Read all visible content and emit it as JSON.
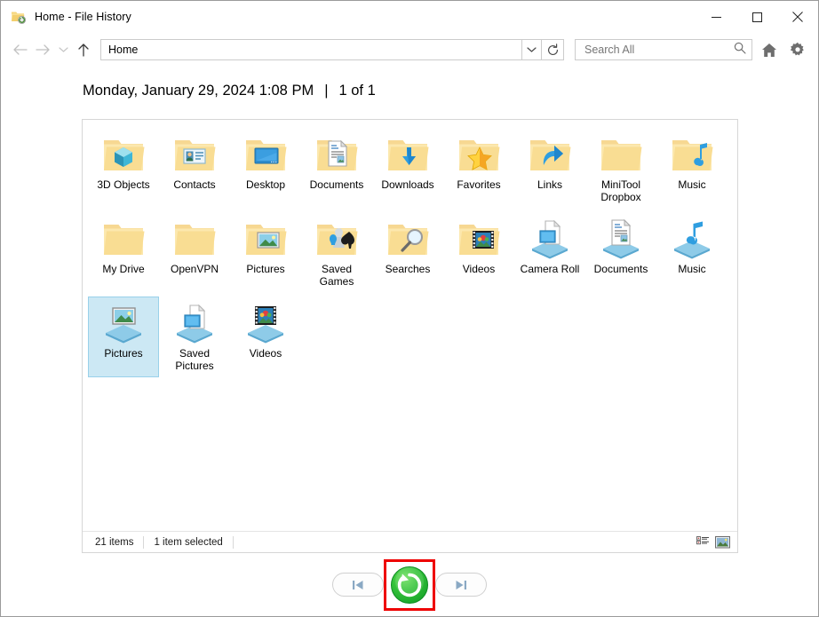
{
  "window": {
    "title": "Home - File History",
    "icon": "folder-history-icon",
    "minimize_label": "Minimize",
    "maximize_label": "Maximize",
    "close_label": "Close"
  },
  "toolbar": {
    "back_label": "Back",
    "forward_label": "Forward",
    "recent_label": "Recent locations",
    "up_label": "Up",
    "address_value": "Home",
    "address_chevron": "chevron-down-icon",
    "refresh_label": "Refresh",
    "search_placeholder": "Search All",
    "search_value": "",
    "home_label": "Home",
    "settings_label": "Settings"
  },
  "header": {
    "datetime": "Monday, January 29, 2024 1:08 PM",
    "separator": "|",
    "version_count": "1 of 1"
  },
  "items": [
    {
      "label": "3D Objects",
      "icon": "folder-3d-objects-icon",
      "selected": false
    },
    {
      "label": "Contacts",
      "icon": "folder-contacts-icon",
      "selected": false
    },
    {
      "label": "Desktop",
      "icon": "folder-desktop-icon",
      "selected": false
    },
    {
      "label": "Documents",
      "icon": "folder-documents-icon",
      "selected": false
    },
    {
      "label": "Downloads",
      "icon": "folder-downloads-icon",
      "selected": false
    },
    {
      "label": "Favorites",
      "icon": "folder-favorites-icon",
      "selected": false
    },
    {
      "label": "Links",
      "icon": "folder-links-icon",
      "selected": false
    },
    {
      "label": "MiniTool Dropbox",
      "icon": "folder-plain-icon",
      "selected": false
    },
    {
      "label": "Music",
      "icon": "folder-music-icon",
      "selected": false
    },
    {
      "label": "My Drive",
      "icon": "folder-plain-icon",
      "selected": false
    },
    {
      "label": "OpenVPN",
      "icon": "folder-plain-icon",
      "selected": false
    },
    {
      "label": "Pictures",
      "icon": "folder-pictures-icon",
      "selected": false
    },
    {
      "label": "Saved Games",
      "icon": "folder-saved-games-icon",
      "selected": false
    },
    {
      "label": "Searches",
      "icon": "folder-searches-icon",
      "selected": false
    },
    {
      "label": "Videos",
      "icon": "folder-videos-icon",
      "selected": false
    },
    {
      "label": "Camera Roll",
      "icon": "library-camera-roll-icon",
      "selected": false
    },
    {
      "label": "Documents",
      "icon": "library-documents-icon",
      "selected": false
    },
    {
      "label": "Music",
      "icon": "library-music-icon",
      "selected": false
    },
    {
      "label": "Pictures",
      "icon": "library-pictures-icon",
      "selected": true
    },
    {
      "label": "Saved Pictures",
      "icon": "library-saved-pictures-icon",
      "selected": false
    },
    {
      "label": "Videos",
      "icon": "library-videos-icon",
      "selected": false
    }
  ],
  "status": {
    "item_count": "21 items",
    "selection": "1 item selected",
    "details_view_label": "Details view",
    "large_icons_view_label": "Large icons view"
  },
  "bottom_nav": {
    "previous_label": "Previous version",
    "restore_label": "Restore to original location",
    "next_label": "Next version",
    "restore_color": "#2cb431",
    "highlight_color": "#ee0000"
  }
}
